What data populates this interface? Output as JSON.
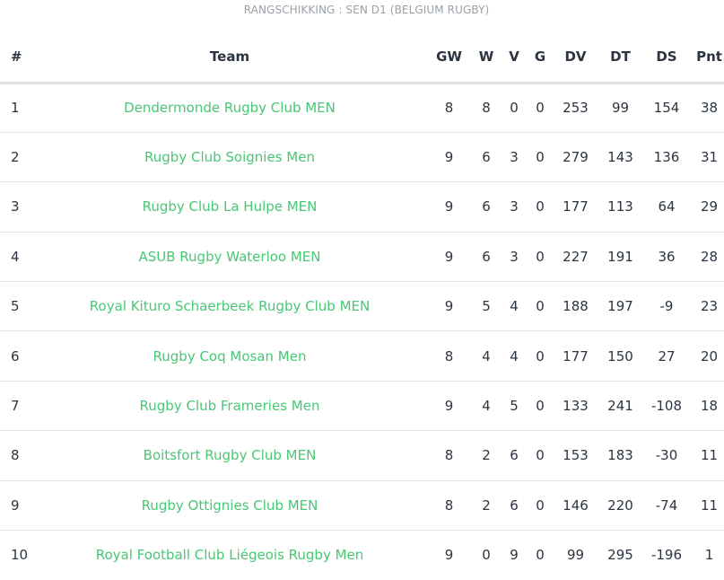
{
  "caption": "RANGSCHIKKING : SEN D1 (BELGIUM RUGBY)",
  "columns": {
    "pos": "#",
    "team": "Team",
    "gw": "GW",
    "w": "W",
    "v": "V",
    "g": "G",
    "dv": "DV",
    "dt": "DT",
    "ds": "DS",
    "pnt": "Pnt"
  },
  "rows": [
    {
      "pos": "1",
      "team": "Dendermonde Rugby Club MEN",
      "gw": "8",
      "w": "8",
      "v": "0",
      "g": "0",
      "dv": "253",
      "dt": "99",
      "ds": "154",
      "pnt": "38"
    },
    {
      "pos": "2",
      "team": "Rugby Club Soignies Men",
      "gw": "9",
      "w": "6",
      "v": "3",
      "g": "0",
      "dv": "279",
      "dt": "143",
      "ds": "136",
      "pnt": "31"
    },
    {
      "pos": "3",
      "team": "Rugby Club La Hulpe MEN",
      "gw": "9",
      "w": "6",
      "v": "3",
      "g": "0",
      "dv": "177",
      "dt": "113",
      "ds": "64",
      "pnt": "29"
    },
    {
      "pos": "4",
      "team": "ASUB Rugby Waterloo MEN",
      "gw": "9",
      "w": "6",
      "v": "3",
      "g": "0",
      "dv": "227",
      "dt": "191",
      "ds": "36",
      "pnt": "28"
    },
    {
      "pos": "5",
      "team": "Royal Kituro Schaerbeek Rugby Club MEN",
      "gw": "9",
      "w": "5",
      "v": "4",
      "g": "0",
      "dv": "188",
      "dt": "197",
      "ds": "-9",
      "pnt": "23"
    },
    {
      "pos": "6",
      "team": "Rugby Coq Mosan Men",
      "gw": "8",
      "w": "4",
      "v": "4",
      "g": "0",
      "dv": "177",
      "dt": "150",
      "ds": "27",
      "pnt": "20"
    },
    {
      "pos": "7",
      "team": "Rugby Club Frameries Men",
      "gw": "9",
      "w": "4",
      "v": "5",
      "g": "0",
      "dv": "133",
      "dt": "241",
      "ds": "-108",
      "pnt": "18"
    },
    {
      "pos": "8",
      "team": "Boitsfort Rugby Club MEN",
      "gw": "8",
      "w": "2",
      "v": "6",
      "g": "0",
      "dv": "153",
      "dt": "183",
      "ds": "-30",
      "pnt": "11"
    },
    {
      "pos": "9",
      "team": "Rugby Ottignies Club MEN",
      "gw": "8",
      "w": "2",
      "v": "6",
      "g": "0",
      "dv": "146",
      "dt": "220",
      "ds": "-74",
      "pnt": "11"
    },
    {
      "pos": "10",
      "team": "Royal Football Club Liégeois Rugby Men",
      "gw": "9",
      "w": "0",
      "v": "9",
      "g": "0",
      "dv": "99",
      "dt": "295",
      "ds": "-196",
      "pnt": "1"
    }
  ],
  "colors": {
    "team_link": "#48c774",
    "text": "#2b3440",
    "caption": "#9aa1a8",
    "divider": "#dee2e6"
  }
}
